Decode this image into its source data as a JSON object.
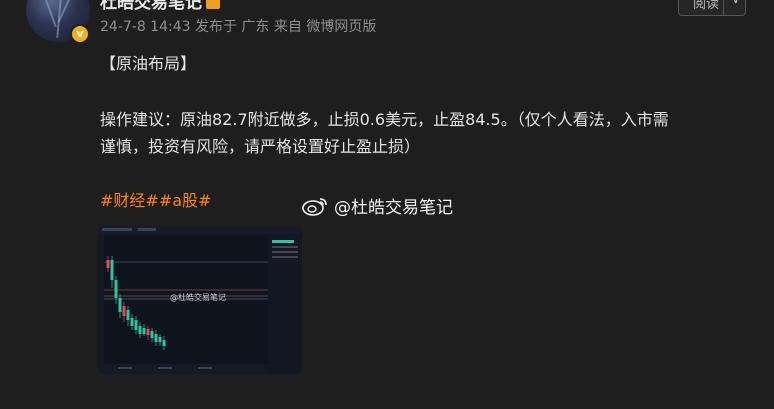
{
  "post": {
    "author": "杜皓交易笔记",
    "timestamp": "24-7-8 14:43",
    "location": "发布于 广东",
    "source": "来自 微博网页版",
    "follow_label": "阅读",
    "title": "【原油布局】",
    "line1": "操作建议：原油82.7附近做多，止损0.6美元，止盈84.5。（仅个人看法，入市需",
    "line2": "谨慎，投资有风险，请严格设置好止盈止损）",
    "topics": "#财经##a股#"
  },
  "watermark": "@杜皓交易笔记",
  "image_watermark": "@杜皓交易笔记",
  "colors": {
    "background": "#1e1e1e",
    "topic": "#ff8400",
    "verified_badge": "#f2b01e",
    "candle_up": "#e64a5a",
    "candle_down": "#2ec4a0"
  },
  "icons": [
    "avatar",
    "verified-icon",
    "weibo-logo-icon",
    "chevron-down-icon"
  ]
}
